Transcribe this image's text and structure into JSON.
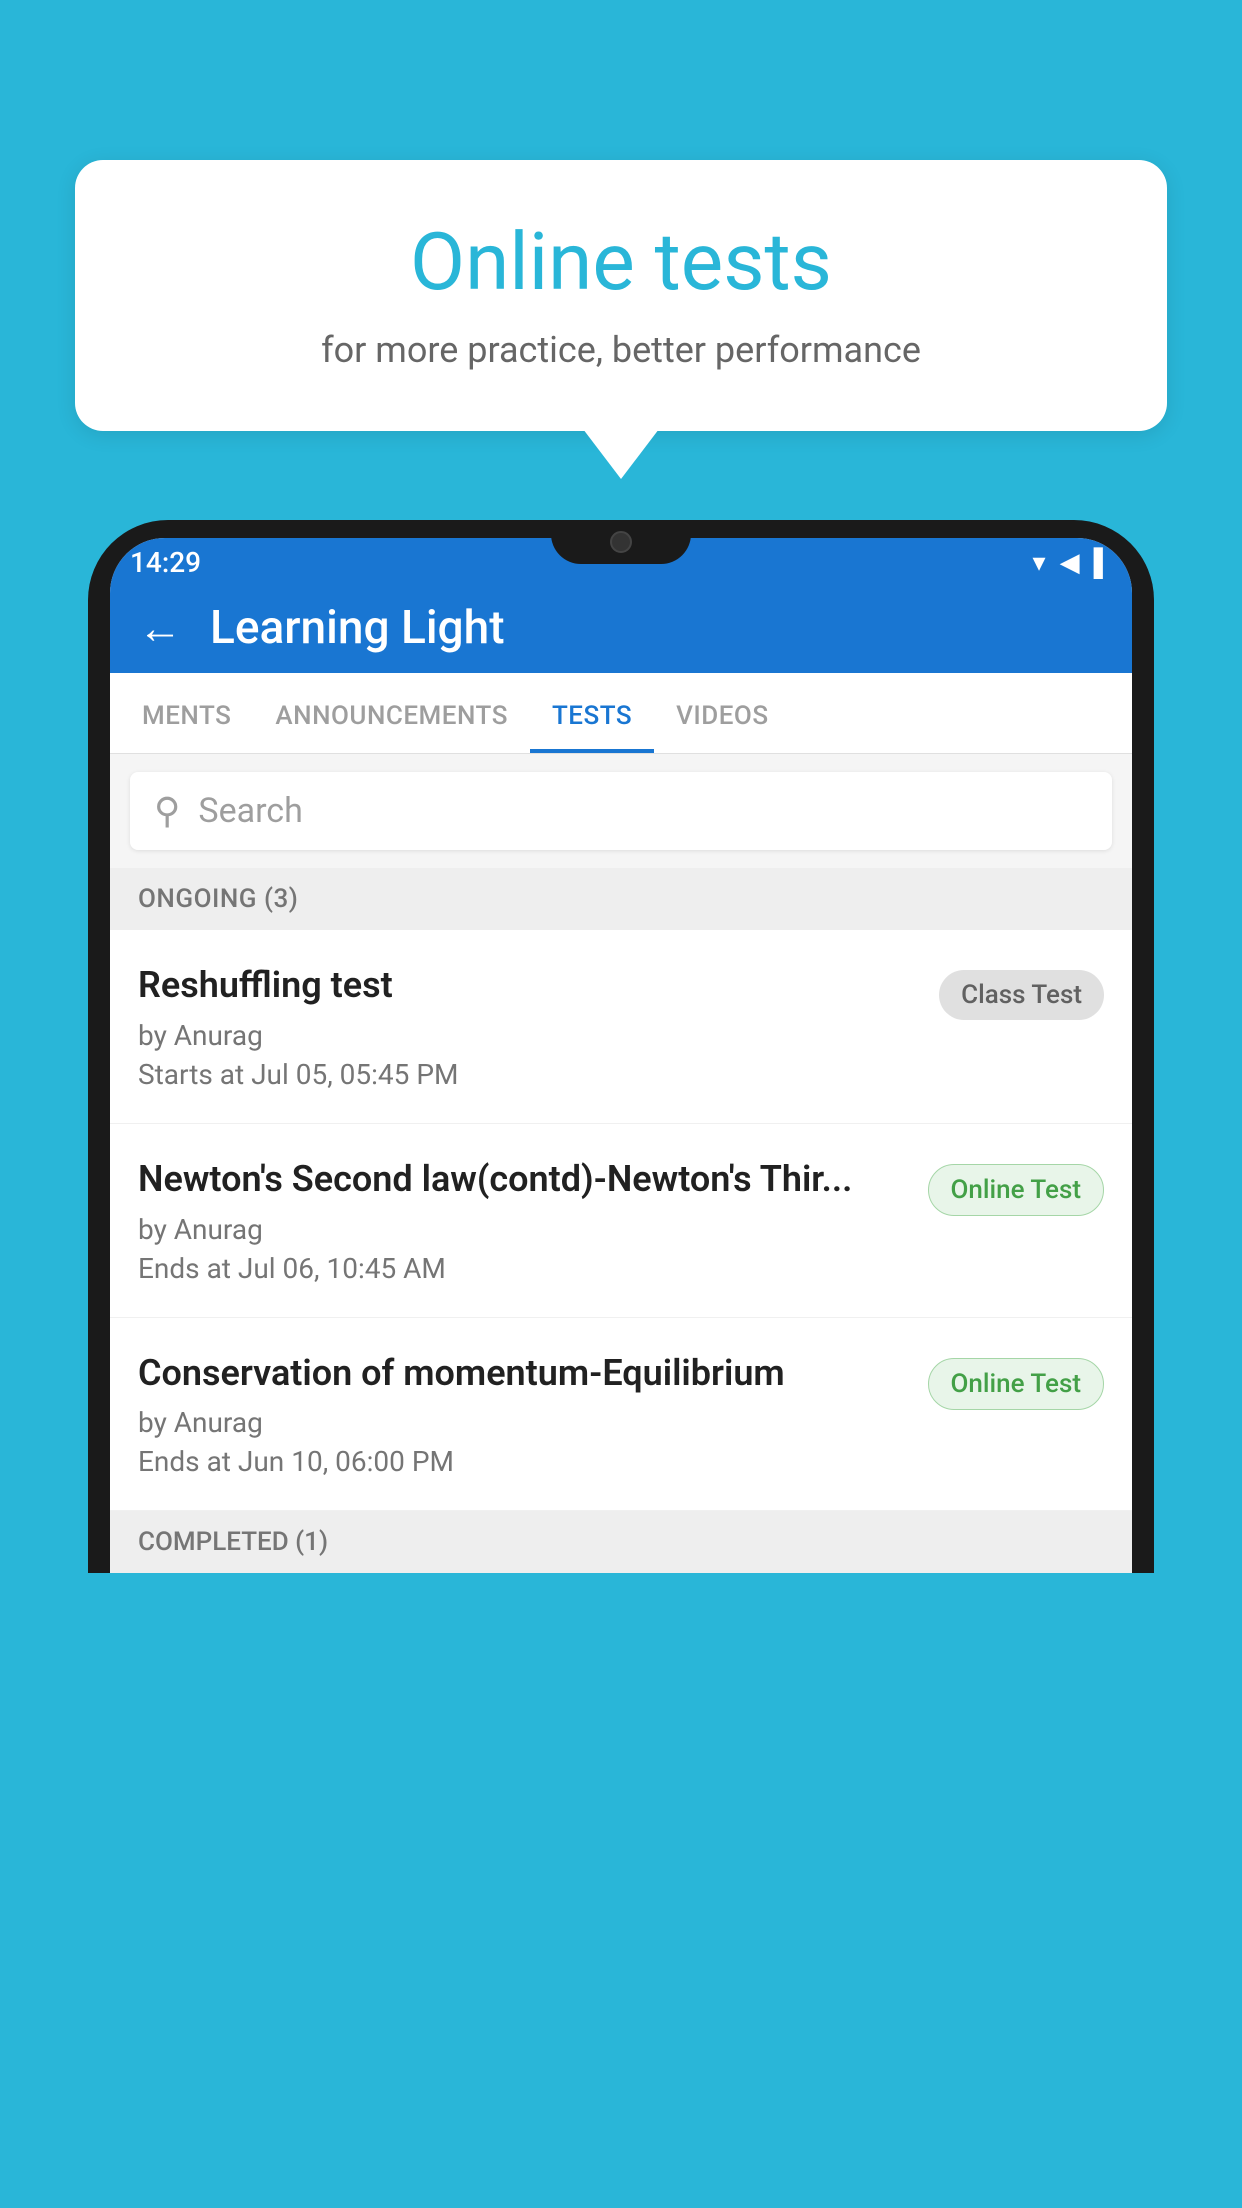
{
  "background_color": "#29b6d8",
  "bubble": {
    "title": "Online tests",
    "subtitle": "for more practice, better performance"
  },
  "phone": {
    "status_bar": {
      "time": "14:29",
      "icons": [
        "▾",
        "▲",
        "▌"
      ]
    },
    "header": {
      "back_label": "←",
      "title": "Learning Light"
    },
    "tabs": [
      {
        "label": "MENTS",
        "active": false
      },
      {
        "label": "ANNOUNCEMENTS",
        "active": false
      },
      {
        "label": "TESTS",
        "active": true
      },
      {
        "label": "VIDEOS",
        "active": false
      }
    ],
    "search": {
      "placeholder": "Search"
    },
    "ongoing_section": {
      "label": "ONGOING (3)"
    },
    "tests": [
      {
        "name": "Reshuffling test",
        "by": "by Anurag",
        "date_label": "Starts at",
        "date": "Jul 05, 05:45 PM",
        "badge": "Class Test",
        "badge_type": "class"
      },
      {
        "name": "Newton's Second law(contd)-Newton's Thir...",
        "by": "by Anurag",
        "date_label": "Ends at",
        "date": "Jul 06, 10:45 AM",
        "badge": "Online Test",
        "badge_type": "online"
      },
      {
        "name": "Conservation of momentum-Equilibrium",
        "by": "by Anurag",
        "date_label": "Ends at",
        "date": "Jun 10, 06:00 PM",
        "badge": "Online Test",
        "badge_type": "online"
      }
    ],
    "completed_section": {
      "label": "COMPLETED (1)"
    }
  }
}
